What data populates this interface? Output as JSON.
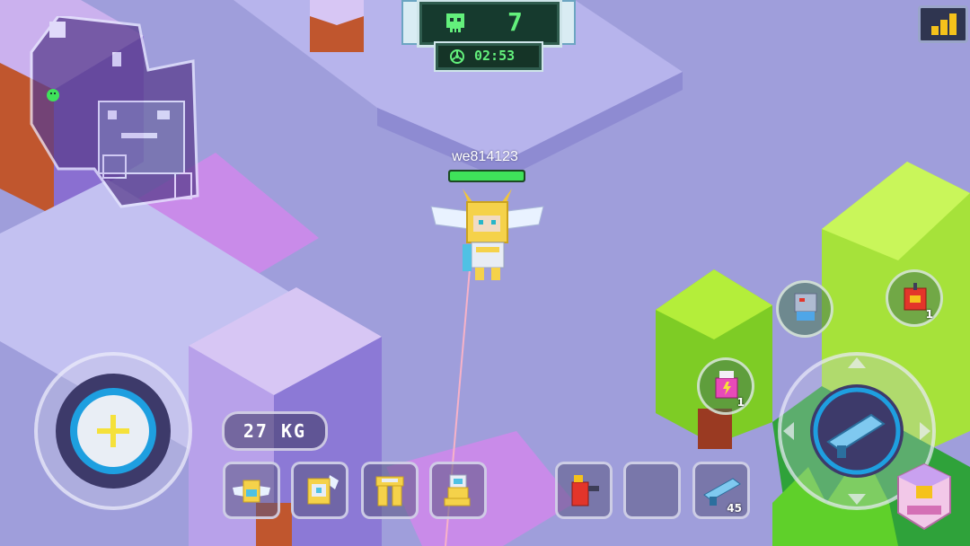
{
  "hud": {
    "players_alive": "7",
    "timer": "02:53",
    "skull_icon": "skull-icon",
    "biohazard_icon": "biohazard-icon",
    "signal_icon": "signal-bars-icon"
  },
  "player": {
    "name": "we814123",
    "health": 1.0
  },
  "inventory": {
    "weight": "27 KG",
    "armor_slots": [
      {
        "icon": "winged-helmet-icon"
      },
      {
        "icon": "winged-chest-armor-icon"
      },
      {
        "icon": "golden-leg-armor-icon"
      },
      {
        "icon": "golden-boots-icon"
      }
    ],
    "item_slots": [
      {
        "icon": "red-turret-icon",
        "qty": ""
      },
      {
        "icon": "empty-slot",
        "qty": ""
      },
      {
        "icon": "blue-blaster-icon",
        "qty": "45"
      }
    ]
  },
  "quick_items": [
    {
      "icon": "robot-drone-icon",
      "qty": ""
    },
    {
      "icon": "red-dynamite-icon",
      "qty": "1"
    },
    {
      "icon": "pink-medkit-icon",
      "qty": "1"
    }
  ],
  "weapon": {
    "icon": "blue-blaster-icon"
  },
  "colors": {
    "accent_green": "#63f07c",
    "hud_blue": "#1e9fe0",
    "move_button_yellow": "#f5e13a"
  }
}
